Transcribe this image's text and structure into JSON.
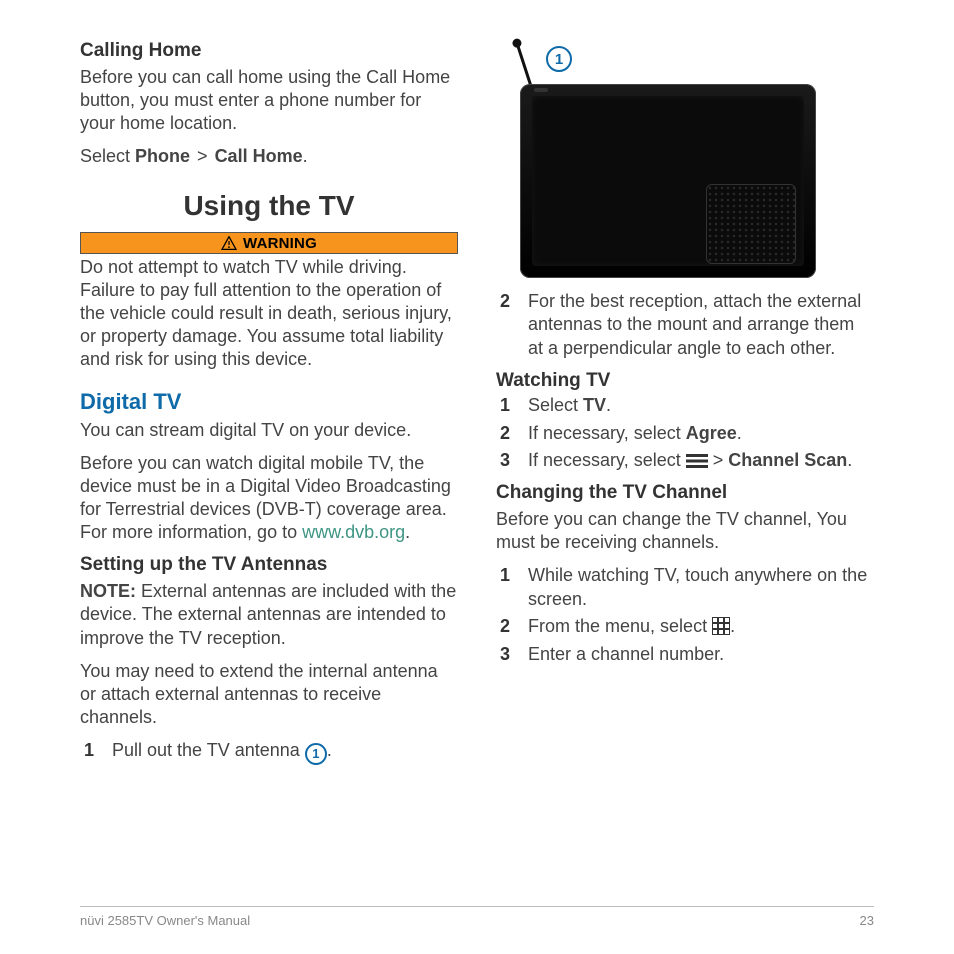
{
  "left": {
    "calling_home_h": "Calling Home",
    "calling_home_p": "Before you can call home using the Call Home button, you must enter a phone number for your home location.",
    "select_word": "Select ",
    "phone_b": "Phone",
    "gt": " > ",
    "call_home_b": "Call Home",
    "period": ".",
    "using_tv_h": "Using the TV",
    "warning_label": "WARNING",
    "warning_p": "Do not attempt to watch TV while driving. Failure to pay full attention to the operation of the vehicle could result in death, serious injury, or property damage. You assume total liability and risk for using this device.",
    "digital_tv_h": "Digital TV",
    "digital_tv_p1": "You can stream digital TV on your device.",
    "digital_tv_p2a": "Before you can watch digital mobile TV, the device must be in a Digital Video Broadcasting for Terrestrial devices (DVB-T) coverage area. For more information, go to ",
    "digital_tv_link": "www.dvb.org",
    "setting_ant_h": "Setting up the TV Antennas",
    "note_b": "NOTE:",
    "note_p": " External antennas are included with the device. The external antennas are intended to improve the TV reception.",
    "ant_p2": "You may need to extend the internal antenna or attach external antennas to receive channels.",
    "step1_pre": "Pull out the TV antenna ",
    "callout_1": "1"
  },
  "right": {
    "fig_callout": "1",
    "step2": "For the best reception, attach the external antennas to the mount and arrange them at a perpendicular angle to each other.",
    "watching_h": "Watching TV",
    "w1_a": "Select ",
    "w1_b": "TV",
    "w2_a": "If necessary, select ",
    "w2_b": "Agree",
    "w3_a": "If necessary, select ",
    "w3_gt": " > ",
    "w3_b": "Channel Scan",
    "changing_h": "Changing the TV Channel",
    "changing_p": "Before you can change the TV channel, You must be receiving channels.",
    "c1": "While watching TV, touch anywhere on the screen.",
    "c2_a": "From the menu, select ",
    "c3": "Enter a channel number."
  },
  "footer": {
    "left": "nüvi 2585TV Owner's Manual",
    "right": "23"
  }
}
